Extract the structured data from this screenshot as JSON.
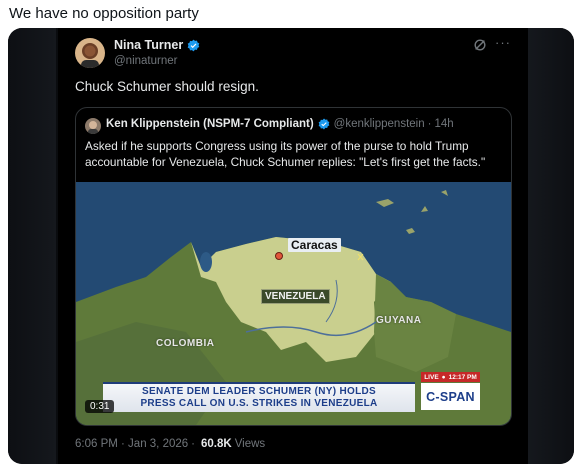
{
  "caption": "We have no opposition party",
  "tweet": {
    "author_name": "Nina Turner",
    "author_handle": "@ninaturner",
    "text": "Chuck Schumer should resign.",
    "more_label": "···",
    "timestamp": "6:06 PM · Jan 3, 2026",
    "separator": "·",
    "views_count": "60.8K",
    "views_label": "Views"
  },
  "quote": {
    "author_name": "Ken Klippenstein (NSPM-7 Compliant)",
    "author_handle": "@kenklippenstein",
    "separator": "·",
    "time": "14h",
    "text": "Asked if he supports Congress using its power of the purse to hold Trump accountable for Venezuela, Chuck Schumer replies: \"Let's first get the facts.\""
  },
  "video": {
    "duration": "0:31",
    "map_labels": {
      "caracas": "Caracas",
      "venezuela": "VENEZUELA",
      "colombia": "COLOMBIA",
      "guyana": "GUYANA"
    },
    "lower_third": {
      "line1": "SENATE DEM LEADER SCHUMER (NY) HOLDS",
      "line2": "PRESS CALL ON U.S. STRIKES IN VENEZUELA"
    },
    "live_label": "LIVE",
    "live_time": "12:17 PM",
    "network": "C-SPAN"
  },
  "colors": {
    "verified": "#1d9bf0",
    "text_primary": "#e7e9ea",
    "text_secondary": "#71767b",
    "cspan_blue": "#1d3e8a"
  },
  "icons": {
    "verified": "verified-badge-icon",
    "grok": "grok-icon",
    "more": "more-icon"
  }
}
